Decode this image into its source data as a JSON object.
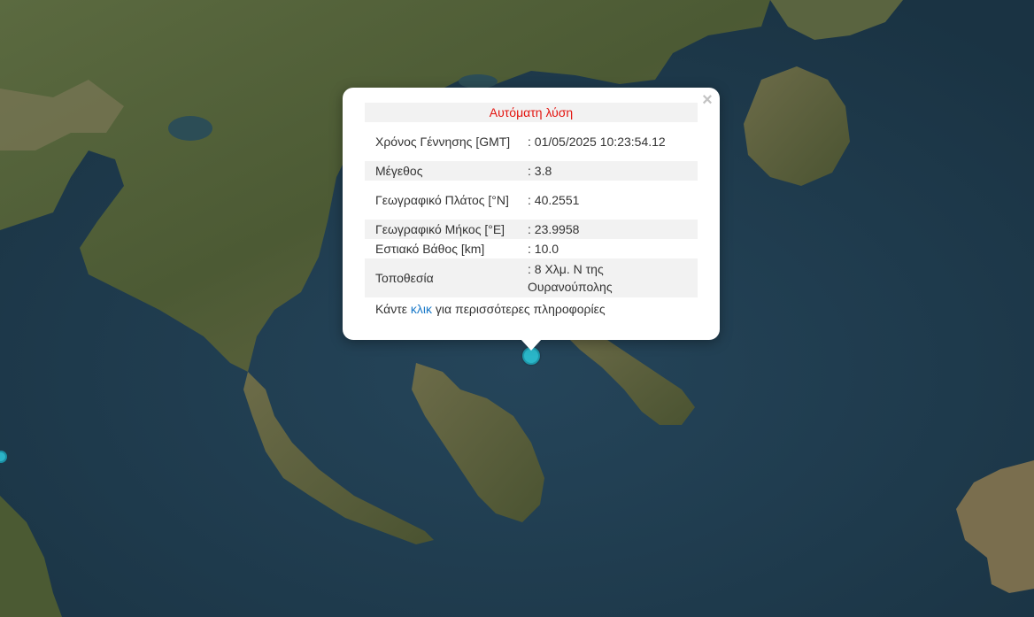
{
  "popup": {
    "close_symbol": "×",
    "close_icon": "close-icon",
    "title": "Αυτόματη λύση",
    "rows": [
      {
        "label": "Χρόνος Γέννησης [GMT]",
        "value": ": 01/05/2025 10:23:54.12"
      },
      {
        "label": "Μέγεθος",
        "value": ": 3.8"
      },
      {
        "label": "Γεωγραφικό Πλάτος [°N]",
        "value": ": 40.2551"
      },
      {
        "label": "Γεωγραφικό Μήκος [°E]",
        "value": ": 23.9958"
      },
      {
        "label": "Εστιακό Βάθος [km]",
        "value": ": 10.0"
      },
      {
        "label": "Τοποθεσία",
        "value": ": 8 Χλμ. Ν της Ουρανούπολης"
      }
    ],
    "more_prefix": "Κάντε ",
    "more_link": "κλικ",
    "more_suffix": " για περισσότερες πληροφορίες"
  },
  "colors": {
    "sea": "#1f3a4a",
    "land": "#56603c",
    "marker": "#2ab6c8",
    "title_text": "#e3140f",
    "link": "#1a79c8"
  }
}
